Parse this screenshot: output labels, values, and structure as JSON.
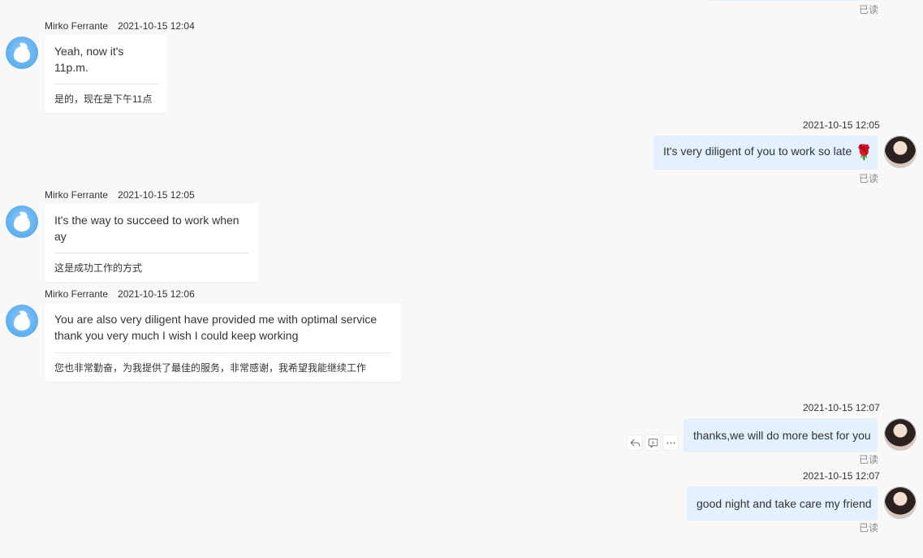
{
  "read_label": "已读",
  "messages": [
    {
      "sender": "Mirko Ferrante",
      "time": "2021-10-15 12:04",
      "text": "Yeah, now it's 11p.m.",
      "translation": "是的，现在是下午11点"
    },
    {
      "time": "2021-10-15 12:05",
      "text": "It's very diligent of you to work so late",
      "emoji": "🌹",
      "status": "已读"
    },
    {
      "sender": "Mirko Ferrante",
      "time": "2021-10-15 12:05",
      "text": "It's the way to succeed to work when ay",
      "translation": "这是成功工作的方式"
    },
    {
      "sender": "Mirko Ferrante",
      "time": "2021-10-15 12:06",
      "text_line1": "You are also very diligent have provided me with optimal service",
      "text_line2": "thank you very much I wish I could keep working",
      "translation": "您也非常勤奋，为我提供了最佳的服务，非常感谢，我希望我能继续工作"
    },
    {
      "time": "2021-10-15 12:07",
      "text": "thanks,we will do more best for you",
      "status": "已读"
    },
    {
      "time": "2021-10-15 12:07",
      "text": "good night and take care my friend",
      "status": "已读"
    }
  ],
  "icons": {
    "incoming_avatar": "contact-avatar-icon",
    "outgoing_avatar": "user-avatar",
    "reply": "reply-icon",
    "translate": "translate-icon",
    "more": "more-icon"
  },
  "colors": {
    "background": "#f8f8f8",
    "incoming_bubble": "#ffffff",
    "outgoing_bubble": "#e3f0fd",
    "avatar_blue": "#5aaef0"
  }
}
